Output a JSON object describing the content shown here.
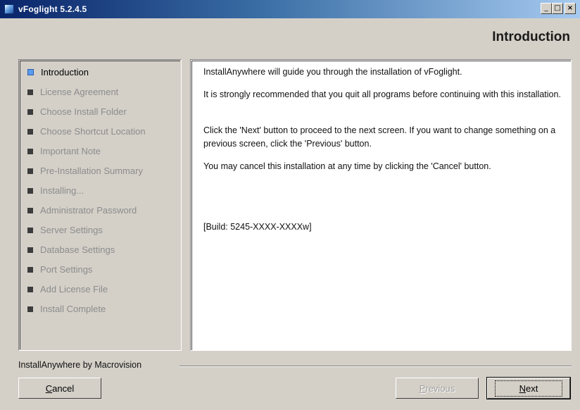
{
  "window": {
    "title": "vFoglight 5.2.4.5",
    "controls": {
      "minimize": "_",
      "maximize": "□",
      "close": "×"
    }
  },
  "page": {
    "heading": "Introduction"
  },
  "steps": [
    {
      "label": "Introduction",
      "active": true
    },
    {
      "label": "License Agreement",
      "active": false
    },
    {
      "label": "Choose Install Folder",
      "active": false
    },
    {
      "label": "Choose Shortcut Location",
      "active": false
    },
    {
      "label": "Important Note",
      "active": false
    },
    {
      "label": "Pre-Installation Summary",
      "active": false
    },
    {
      "label": "Installing...",
      "active": false
    },
    {
      "label": "Administrator Password",
      "active": false
    },
    {
      "label": "Server Settings",
      "active": false
    },
    {
      "label": "Database Settings",
      "active": false
    },
    {
      "label": "Port Settings",
      "active": false
    },
    {
      "label": "Add License File",
      "active": false
    },
    {
      "label": "Install Complete",
      "active": false
    }
  ],
  "content": {
    "p1": "InstallAnywhere will guide you through the installation of vFoglight.",
    "p2": "It is strongly recommended that you quit all programs before continuing with this installation.",
    "p3": "Click the 'Next' button to proceed to the next screen. If you want to change something on a previous screen, click the 'Previous' button.",
    "p4": "You may cancel this installation at any time by clicking the 'Cancel' button.",
    "build": "[Build: 5245-XXXX-XXXXw]"
  },
  "footer": {
    "vendor": "InstallAnywhere by Macrovision",
    "cancel": {
      "mnemonic": "C",
      "rest": "ancel"
    },
    "previous": {
      "mnemonic": "P",
      "rest": "revious"
    },
    "next": {
      "mnemonic": "N",
      "rest": "ext"
    }
  },
  "colors": {
    "title_gradient_start": "#0a246a",
    "title_gradient_end": "#a6caf0",
    "active_bullet": "#5b9bf0",
    "inactive_step_text": "#8c8c8c",
    "face": "#d4d0c8"
  }
}
